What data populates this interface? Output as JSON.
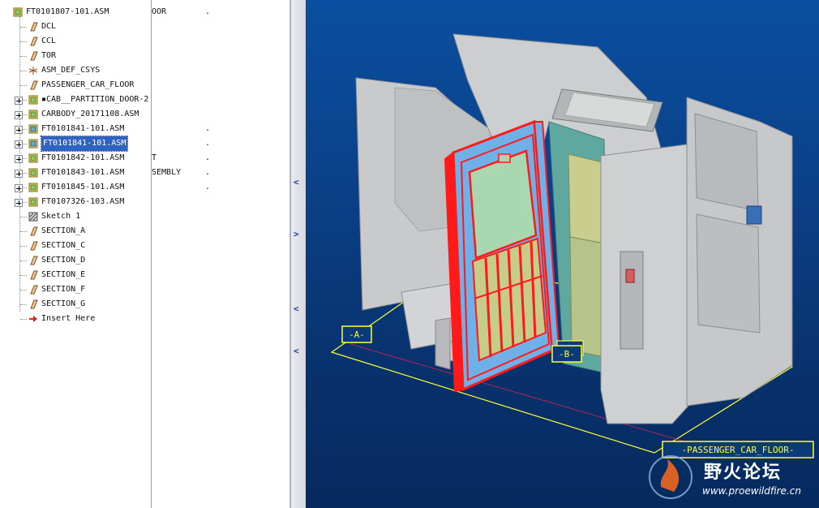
{
  "tree": {
    "root": "FT0101807-101.ASM",
    "items": [
      {
        "label": "DCL",
        "icon": "datum-plane-icon",
        "expandable": false
      },
      {
        "label": "CCL",
        "icon": "datum-plane-icon",
        "expandable": false
      },
      {
        "label": "TOR",
        "icon": "datum-plane-icon",
        "expandable": false
      },
      {
        "label": "ASM_DEF_CSYS",
        "icon": "csys-icon",
        "expandable": false
      },
      {
        "label": "PASSENGER_CAR_FLOOR",
        "icon": "datum-plane-icon",
        "expandable": false
      },
      {
        "label": "▪CAB__PARTITION_DOOR-2",
        "icon": "assembly-icon",
        "expandable": true
      },
      {
        "label": "CARBODY_20171108.ASM",
        "icon": "assembly-icon",
        "expandable": true
      },
      {
        "label": "FT0101841-101.ASM",
        "icon": "assembly-variant-icon",
        "expandable": true
      },
      {
        "label": "FT0101841-101.ASM",
        "icon": "assembly-variant-icon",
        "expandable": true,
        "selected": true
      },
      {
        "label": "FT0101842-101.ASM",
        "icon": "assembly-icon",
        "expandable": true
      },
      {
        "label": "FT0101843-101.ASM",
        "icon": "assembly-icon",
        "expandable": true
      },
      {
        "label": "FT0101845-101.ASM",
        "icon": "assembly-icon",
        "expandable": true
      },
      {
        "label": "FT0107326-103.ASM",
        "icon": "assembly-icon",
        "expandable": true
      },
      {
        "label": "Sketch 1",
        "icon": "sketch-icon",
        "expandable": false
      },
      {
        "label": "SECTION_A",
        "icon": "datum-plane-icon",
        "expandable": false
      },
      {
        "label": "SECTION_C",
        "icon": "datum-plane-icon",
        "expandable": false
      },
      {
        "label": "SECTION_D",
        "icon": "datum-plane-icon",
        "expandable": false
      },
      {
        "label": "SECTION_E",
        "icon": "datum-plane-icon",
        "expandable": false
      },
      {
        "label": "SECTION_F",
        "icon": "datum-plane-icon",
        "expandable": false
      },
      {
        "label": "SECTION_G",
        "icon": "datum-plane-icon",
        "expandable": false
      },
      {
        "label": "Insert Here",
        "icon": "insert-arrow-icon",
        "expandable": false
      }
    ]
  },
  "column2": {
    "fragments": [
      {
        "text": "OOR",
        "row": 0
      },
      {
        "text": ".",
        "row": 0,
        "right": true
      },
      {
        "text": ".",
        "row": 8,
        "right": true
      },
      {
        "text": ".",
        "row": 9,
        "right": true
      },
      {
        "text": "T",
        "row": 10
      },
      {
        "text": ".",
        "row": 10,
        "right": true
      },
      {
        "text": "SEMBLY",
        "row": 11
      },
      {
        "text": ".",
        "row": 11,
        "right": true
      },
      {
        "text": ".",
        "row": 12,
        "right": true
      }
    ]
  },
  "viewport": {
    "labels": {
      "a": "-A-",
      "b": "-B-",
      "floor": "-PASSENGER_CAR_FLOOR-"
    },
    "colors": {
      "selection": "#ff1a1a",
      "datum": "#ffff33",
      "glass": "#a9d8b0",
      "frame_blue": "#6fb0e8"
    }
  },
  "watermark": {
    "title": "野火论坛",
    "url": "www.proewildfire.cn"
  }
}
